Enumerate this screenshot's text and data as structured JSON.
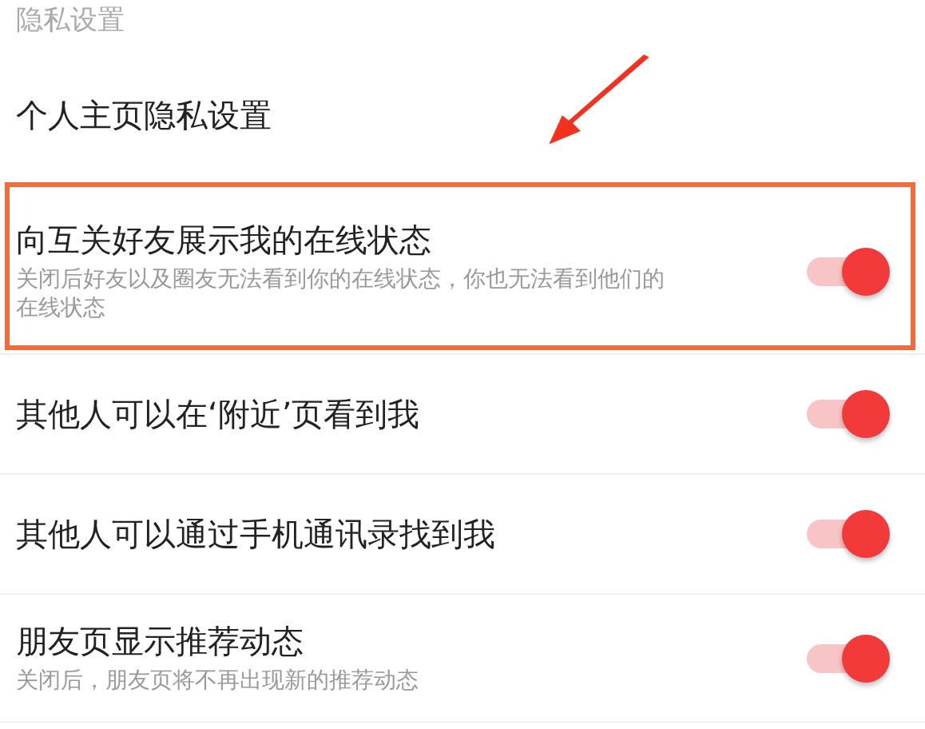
{
  "section_title": "隐私设置",
  "items": [
    {
      "kind": "link",
      "title": "个人主页隐私设置",
      "highlighted": false
    },
    {
      "kind": "toggle",
      "title": "向互关好友展示我的在线状态",
      "subtitle": "关闭后好友以及圈友无法看到你的在线状态，你也无法看到他们的在线状态",
      "on": true,
      "highlighted": true
    },
    {
      "kind": "toggle",
      "title": "其他人可以在‘附近’页看到我",
      "on": true,
      "highlighted": false
    },
    {
      "kind": "toggle",
      "title": "其他人可以通过手机通讯录找到我",
      "on": true,
      "highlighted": false
    },
    {
      "kind": "toggle",
      "title": "朋友页显示推荐动态",
      "subtitle": "关闭后，朋友页将不再出现新的推荐动态",
      "on": true,
      "highlighted": false
    }
  ]
}
